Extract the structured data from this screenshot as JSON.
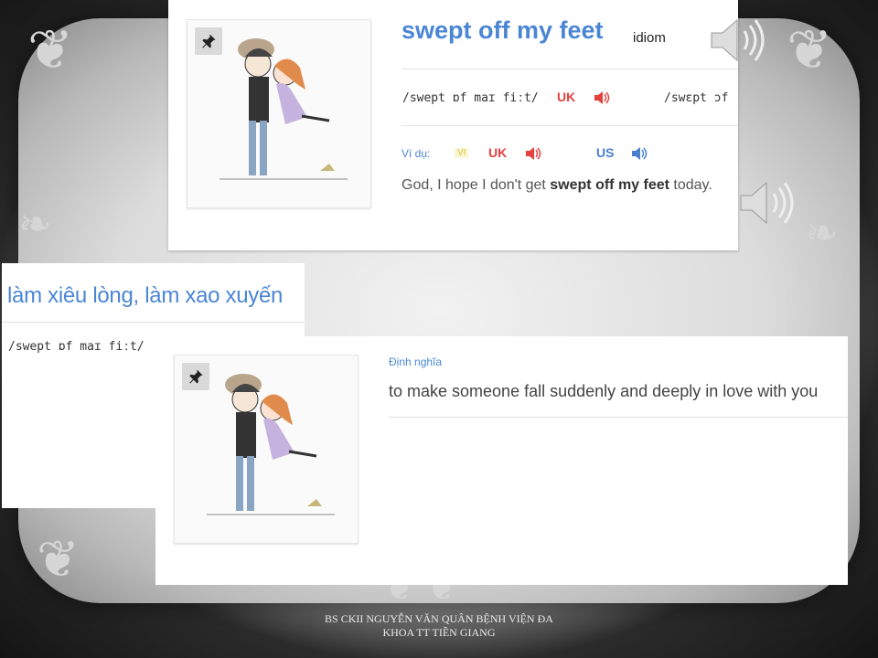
{
  "entry": {
    "headword": "swept off my feet",
    "part_of_speech": "idiom",
    "ipa_uk": "/swept ɒf maɪ fiːt/",
    "ipa_us_partial": "/swɛpt ɔf",
    "uk_label": "UK",
    "us_label": "US",
    "example_label": "Ví dụ:",
    "vi_badge": "VI",
    "example_before": "God, I hope I don't get ",
    "example_bold": "swept off my feet",
    "example_after": " today."
  },
  "translation": {
    "meaning_vi": "làm xiêu lòng, làm xao xuyến",
    "ipa": "/swept ɒf maɪ fiːt/"
  },
  "definition_card": {
    "label": "Định nghĩa",
    "text": "to make someone fall suddenly and deeply in love with you"
  },
  "icons": {
    "pin": "pin-icon",
    "speaker": "speaker-icon",
    "audio": "audio-sound-icon"
  },
  "colors": {
    "accent_blue": "#4b86d4",
    "uk_red": "#e5413f",
    "us_blue": "#4a7fd0",
    "vi_yellow": "#d6bf3c"
  },
  "footer": {
    "line1": "BS CKII NGUYỄN VĂN QUÂN BỆNH VIỆN ĐA",
    "line2": "KHOA TT TIỀN GIANG"
  }
}
